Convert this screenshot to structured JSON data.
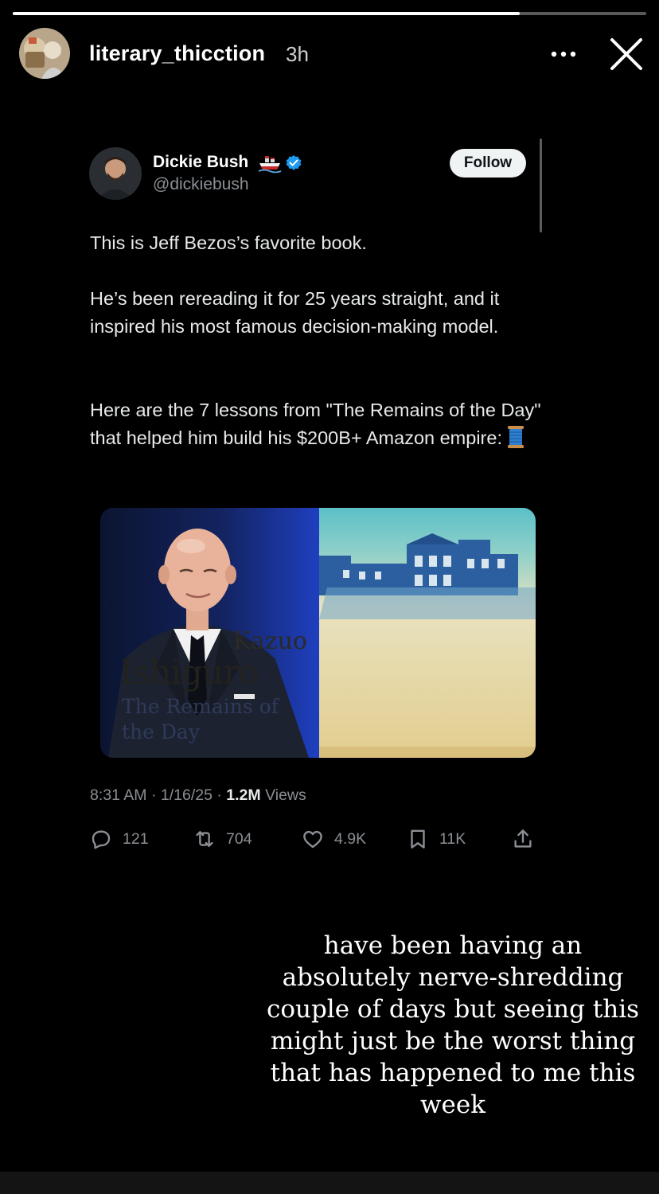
{
  "story": {
    "username": "literary_thicction",
    "time_ago": "3h",
    "progress": 0.8,
    "icons": {
      "more": "more-horizontal-icon",
      "close": "close-icon"
    }
  },
  "tweet": {
    "author_name": "Dickie Bush",
    "author_handle": "@dickiebush",
    "follow_label": "Follow",
    "paragraphs": [
      "This is Jeff Bezos’s favorite book.",
      "He’s been rereading it for 25 years straight, and it inspired his most famous decision-making model.",
      "Here are the 7 lessons from \"The Remains of the Day\" that helped him build his $200B+ Amazon empire:"
    ],
    "book": {
      "author_first": "Kazuo",
      "author_last": "Ishiguro",
      "title": "The Remains of the Day"
    },
    "meta": {
      "time": "8:31 AM",
      "date": "1/16/25",
      "views_count": "1.2M",
      "views_label": "Views"
    },
    "actions": {
      "replies": "121",
      "reposts": "704",
      "likes": "4.9K",
      "bookmarks": "11K"
    },
    "colors": {
      "verified": "#1d9bf0",
      "follow_bg": "#eff3f4",
      "muted_text": "#8b8f94"
    }
  },
  "caption": "have been having an absolutely nerve-shredding couple of days but seeing this might just be the worst thing that has happened to me this week"
}
